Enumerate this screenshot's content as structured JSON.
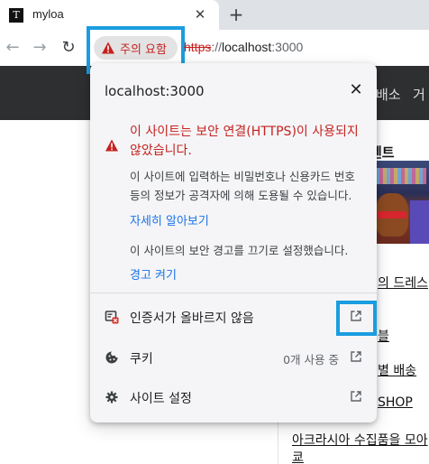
{
  "browser": {
    "tab": {
      "title": "myloa",
      "favicon_letter": "T"
    },
    "new_tab_symbol": "+",
    "close_symbol": "✕"
  },
  "toolbar": {
    "back_icon": "arrow-left-icon",
    "forward_icon": "arrow-right-icon",
    "reload_icon": "reload-icon",
    "security_chip": {
      "label": "주의 요함",
      "icon": "warning-triangle-icon",
      "color": "#c5221f"
    },
    "url": {
      "scheme": "https",
      "separator": "://",
      "host": "localhost",
      "port": ":3000"
    }
  },
  "site_info_popup": {
    "title": "localhost:3000",
    "warning": {
      "title": "이 사이트는 보안 연결(HTTPS)이 사용되지 않았습니다.",
      "body": "이 사이트에 입력하는 비밀번호나 신용카드 번호 등의 정보가 공격자에 의해 도용될 수 있습니다.",
      "learn_more": "자세히 알아보기",
      "disabled_notice": "이 사이트의 보안 경고를 끄기로 설정했습니다.",
      "enable_warnings": "경고 켜기"
    },
    "rows": {
      "certificate": {
        "label": "인증서가 올바르지 않음",
        "icon": "certificate-invalid-icon"
      },
      "cookies": {
        "label": "쿠키",
        "value": "0개 사용 중",
        "icon": "cookie-icon"
      },
      "site_settings": {
        "label": "사이트 설정",
        "icon": "gear-icon"
      }
    },
    "highlight_color": "#1a9de0"
  },
  "page_behind": {
    "header_nav": [
      "배소",
      "거"
    ],
    "side_heading": "벤트",
    "side_links": [
      "의 드레스",
      "블",
      "별 배송",
      "SHOP",
      "아크라시아 수집품을 모아",
      "쿄"
    ]
  }
}
